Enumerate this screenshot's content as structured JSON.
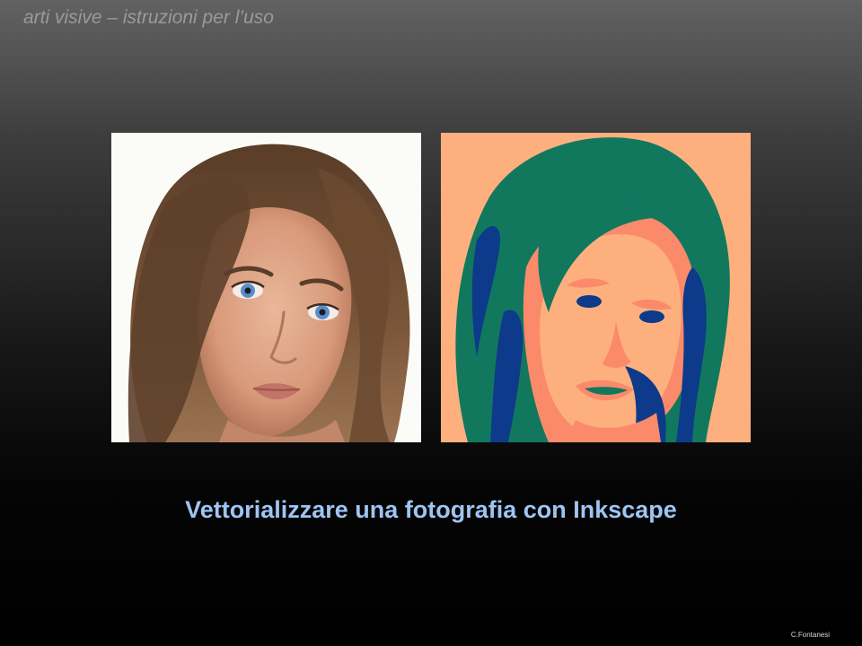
{
  "slide": {
    "header_title": "arti visive – istruzioni per l’uso",
    "caption": "Vettorializzare una fotografia con Inkscape",
    "credit": "C.Fontanesi"
  },
  "images": {
    "original": {
      "kind": "photograph-portrait",
      "palette": [
        "#fbfbf8",
        "#6b4a32",
        "#e1a98c",
        "#5a8ec9"
      ]
    },
    "vectorized": {
      "kind": "posterized-vector-portrait",
      "palette": [
        "#fdb07e",
        "#fb8a6a",
        "#11785e",
        "#0d3a8a"
      ]
    }
  }
}
